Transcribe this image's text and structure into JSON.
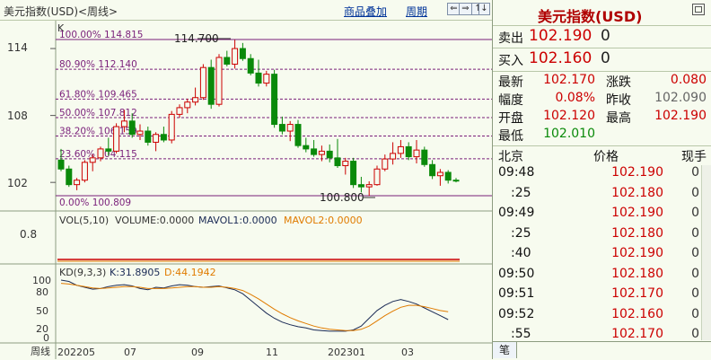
{
  "header": {
    "title": "美元指数(USD)<周线>",
    "menu_overlay": "商品叠加",
    "menu_period": "周期",
    "btn_prev": "⇐",
    "btn_next": "⇒",
    "btn_up": "↑",
    "btn_down": "↓"
  },
  "chart": {
    "corner_label": "K",
    "price_axis": [
      "114",
      "108",
      "102"
    ],
    "fib_levels": [
      {
        "label": "100.00% 114.815",
        "value": 114.815
      },
      {
        "label": "80.90% 112.140",
        "value": 112.14
      },
      {
        "label": "61.80% 109.465",
        "value": 109.465
      },
      {
        "label": "50.00% 107.812",
        "value": 107.812
      },
      {
        "label": "38.20% 106.159",
        "value": 106.159
      },
      {
        "label": "23.60% 104.115",
        "value": 104.115
      },
      {
        "label": "0.00% 100.809",
        "value": 100.809
      }
    ],
    "high_marker": "114.700",
    "low_marker": "100.800",
    "vol_legend": {
      "vol": "VOL(5,10)",
      "volume": "VOLUME:0.0000",
      "mavol1": "MAVOL1:0.0000",
      "mavol2": "MAVOL2:0.0000"
    },
    "vol_axis": [
      "0.8"
    ],
    "kd_legend": {
      "kd": "KD(9,3,3)",
      "k": "K:31.8905",
      "d": "D:44.1942"
    },
    "kd_axis": [
      "100",
      "80",
      "50",
      "20",
      "0"
    ],
    "x_axis": {
      "label": "周线",
      "ticks": [
        "202205",
        "07",
        "09",
        "11",
        "202301",
        "03"
      ]
    },
    "colors": {
      "up": "#cc0000",
      "down": "#0a8a0a",
      "fib": "#7a1f7a",
      "k": "#1a2a55",
      "d": "#e07b00",
      "vol": "#cc0000",
      "grid": "#b9c7a8"
    }
  },
  "chart_data": {
    "type": "candlestick",
    "candles": [
      {
        "o": 104.0,
        "h": 105.0,
        "l": 103.0,
        "c": 103.2
      },
      {
        "o": 103.2,
        "h": 103.5,
        "l": 101.6,
        "c": 101.8
      },
      {
        "o": 101.8,
        "h": 102.4,
        "l": 101.3,
        "c": 102.2
      },
      {
        "o": 102.2,
        "h": 104.0,
        "l": 102.0,
        "c": 103.8
      },
      {
        "o": 103.8,
        "h": 104.5,
        "l": 103.0,
        "c": 104.2
      },
      {
        "o": 104.2,
        "h": 105.2,
        "l": 103.9,
        "c": 105.0
      },
      {
        "o": 105.0,
        "h": 106.0,
        "l": 104.4,
        "c": 104.8
      },
      {
        "o": 104.8,
        "h": 107.3,
        "l": 104.6,
        "c": 107.0
      },
      {
        "o": 107.0,
        "h": 108.5,
        "l": 106.5,
        "c": 107.5
      },
      {
        "o": 107.5,
        "h": 108.2,
        "l": 106.0,
        "c": 106.3
      },
      {
        "o": 106.3,
        "h": 107.2,
        "l": 105.8,
        "c": 106.6
      },
      {
        "o": 106.6,
        "h": 107.0,
        "l": 105.3,
        "c": 105.6
      },
      {
        "o": 105.6,
        "h": 106.5,
        "l": 104.8,
        "c": 106.3
      },
      {
        "o": 106.3,
        "h": 107.0,
        "l": 105.6,
        "c": 105.8
      },
      {
        "o": 105.8,
        "h": 108.4,
        "l": 105.5,
        "c": 108.1
      },
      {
        "o": 108.1,
        "h": 109.0,
        "l": 107.8,
        "c": 108.7
      },
      {
        "o": 108.7,
        "h": 109.5,
        "l": 108.2,
        "c": 109.2
      },
      {
        "o": 109.2,
        "h": 110.5,
        "l": 108.9,
        "c": 109.6
      },
      {
        "o": 109.6,
        "h": 112.6,
        "l": 109.4,
        "c": 112.3
      },
      {
        "o": 112.3,
        "h": 113.0,
        "l": 108.6,
        "c": 109.0
      },
      {
        "o": 109.0,
        "h": 113.5,
        "l": 108.8,
        "c": 113.2
      },
      {
        "o": 113.2,
        "h": 113.8,
        "l": 112.4,
        "c": 112.6
      },
      {
        "o": 112.6,
        "h": 114.78,
        "l": 112.2,
        "c": 114.0
      },
      {
        "o": 114.0,
        "h": 114.5,
        "l": 112.9,
        "c": 113.1
      },
      {
        "o": 113.1,
        "h": 113.5,
        "l": 111.6,
        "c": 111.8
      },
      {
        "o": 111.8,
        "h": 113.0,
        "l": 110.6,
        "c": 110.9
      },
      {
        "o": 110.9,
        "h": 112.0,
        "l": 110.6,
        "c": 111.7
      },
      {
        "o": 111.7,
        "h": 112.1,
        "l": 106.9,
        "c": 107.2
      },
      {
        "o": 107.2,
        "h": 107.9,
        "l": 106.3,
        "c": 106.6
      },
      {
        "o": 106.6,
        "h": 107.5,
        "l": 105.7,
        "c": 107.2
      },
      {
        "o": 107.2,
        "h": 107.6,
        "l": 105.1,
        "c": 105.3
      },
      {
        "o": 105.3,
        "h": 106.0,
        "l": 104.7,
        "c": 105.0
      },
      {
        "o": 105.0,
        "h": 105.8,
        "l": 104.3,
        "c": 104.5
      },
      {
        "o": 104.5,
        "h": 105.3,
        "l": 103.9,
        "c": 104.8
      },
      {
        "o": 104.8,
        "h": 105.4,
        "l": 103.8,
        "c": 104.2
      },
      {
        "o": 104.2,
        "h": 105.9,
        "l": 103.3,
        "c": 103.5
      },
      {
        "o": 103.5,
        "h": 104.2,
        "l": 102.7,
        "c": 103.9
      },
      {
        "o": 103.9,
        "h": 104.2,
        "l": 101.5,
        "c": 101.8
      },
      {
        "o": 101.8,
        "h": 102.5,
        "l": 101.1,
        "c": 101.6
      },
      {
        "o": 101.6,
        "h": 102.1,
        "l": 100.8,
        "c": 101.8
      },
      {
        "o": 101.8,
        "h": 103.5,
        "l": 101.7,
        "c": 103.2
      },
      {
        "o": 103.2,
        "h": 104.5,
        "l": 103.0,
        "c": 104.1
      },
      {
        "o": 104.1,
        "h": 105.6,
        "l": 103.6,
        "c": 104.6
      },
      {
        "o": 104.6,
        "h": 105.8,
        "l": 104.2,
        "c": 105.2
      },
      {
        "o": 105.2,
        "h": 105.6,
        "l": 104.0,
        "c": 104.3
      },
      {
        "o": 104.3,
        "h": 105.8,
        "l": 103.7,
        "c": 104.9
      },
      {
        "o": 104.9,
        "h": 105.2,
        "l": 103.4,
        "c": 103.6
      },
      {
        "o": 103.6,
        "h": 104.0,
        "l": 102.3,
        "c": 102.6
      },
      {
        "o": 102.6,
        "h": 103.2,
        "l": 101.7,
        "c": 102.9
      },
      {
        "o": 102.9,
        "h": 103.1,
        "l": 101.9,
        "c": 102.2
      },
      {
        "o": 102.2,
        "h": 102.4,
        "l": 102.0,
        "c": 102.17
      }
    ],
    "kd_k": [
      93,
      91,
      85,
      82,
      79,
      80,
      83,
      85,
      86,
      84,
      80,
      78,
      82,
      81,
      84,
      86,
      85,
      83,
      82,
      83,
      84,
      81,
      78,
      72,
      62,
      52,
      42,
      34,
      28,
      24,
      21,
      19,
      16,
      15,
      14,
      14,
      14,
      16,
      22,
      34,
      46,
      54,
      60,
      63,
      60,
      56,
      50,
      44,
      38,
      32
    ],
    "kd_d": [
      88,
      87,
      85,
      83,
      81,
      80,
      81,
      82,
      83,
      83,
      82,
      80,
      80,
      80,
      81,
      82,
      83,
      83,
      82,
      82,
      83,
      82,
      80,
      77,
      71,
      64,
      56,
      48,
      41,
      35,
      30,
      26,
      22,
      19,
      17,
      16,
      15,
      15,
      17,
      22,
      30,
      38,
      45,
      51,
      54,
      54,
      52,
      49,
      46,
      44
    ],
    "ylim": [
      99.6,
      116.5
    ],
    "kd_ylim": [
      0,
      100
    ]
  },
  "quote": {
    "title": "美元指数(USD)",
    "sell_label": "卖出",
    "sell_value": "102.190",
    "sell_vol": "0",
    "buy_label": "买入",
    "buy_value": "102.160",
    "buy_vol": "0",
    "latest_label": "最新",
    "latest_value": "102.170",
    "change_label": "涨跌",
    "change_value": "0.080",
    "range_label": "幅度",
    "range_value": "0.08%",
    "prevclose_label": "昨收",
    "prevclose_value": "102.090",
    "open_label": "开盘",
    "open_value": "102.120",
    "high_label": "最高",
    "high_value": "102.190",
    "low_label": "最低",
    "low_value": "102.010"
  },
  "ticks": {
    "headers": {
      "time": "北京",
      "price": "价格",
      "vol": "现手"
    },
    "rows": [
      {
        "time": "09:48",
        "price": "102.190",
        "vol": "0"
      },
      {
        "time": ":25",
        "price": "102.180",
        "vol": "0"
      },
      {
        "time": "09:49",
        "price": "102.190",
        "vol": "0"
      },
      {
        "time": ":25",
        "price": "102.180",
        "vol": "0"
      },
      {
        "time": ":40",
        "price": "102.190",
        "vol": "0"
      },
      {
        "time": "09:50",
        "price": "102.180",
        "vol": "0"
      },
      {
        "time": "09:51",
        "price": "102.170",
        "vol": "0"
      },
      {
        "time": "09:52",
        "price": "102.160",
        "vol": "0"
      },
      {
        "time": ":55",
        "price": "102.170",
        "vol": "0"
      }
    ],
    "tab_label": "笔"
  }
}
